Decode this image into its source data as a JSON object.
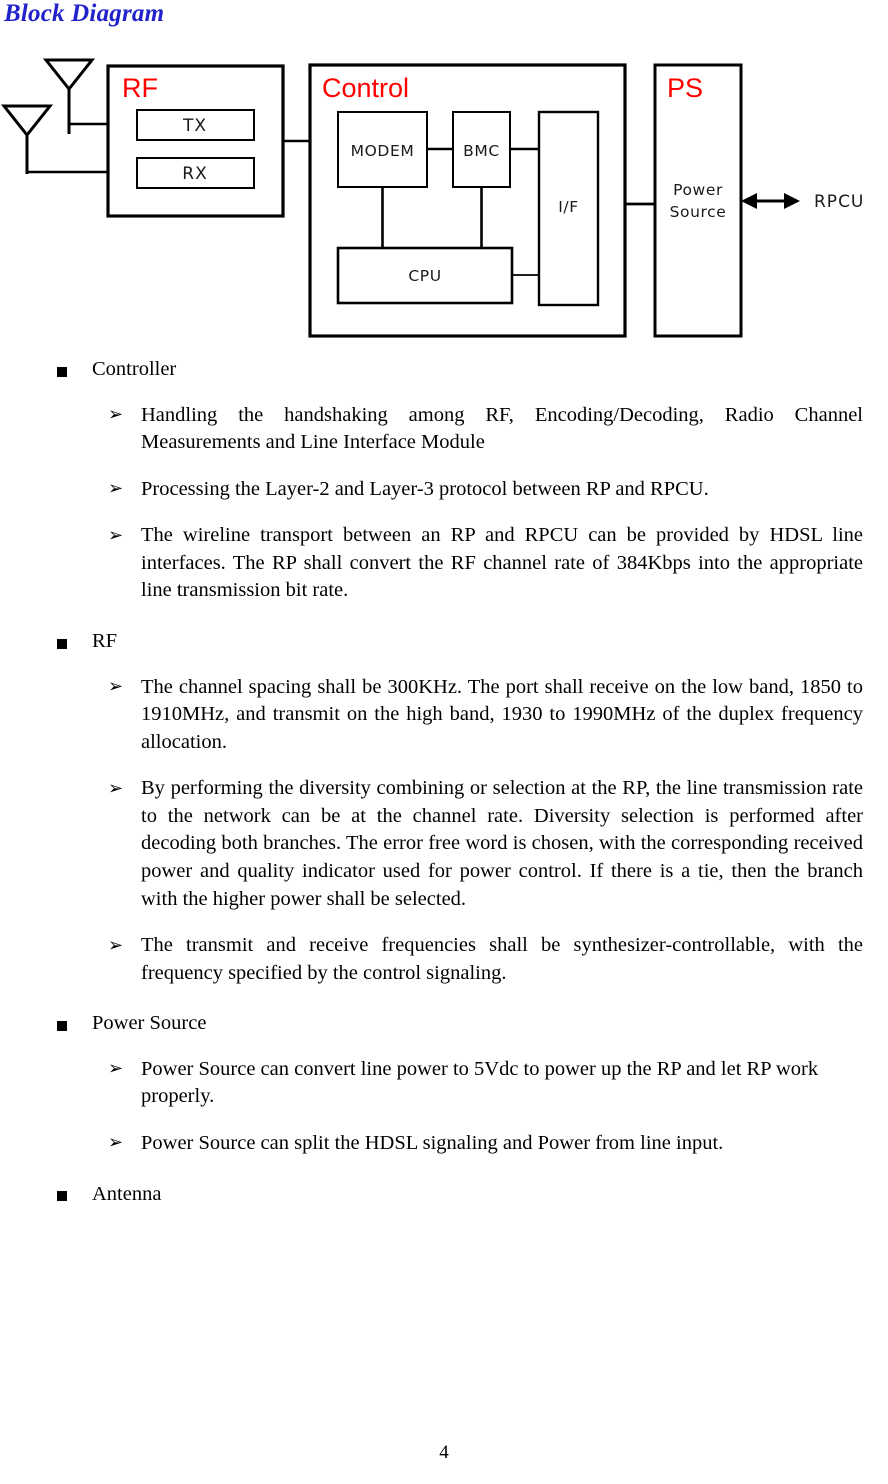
{
  "document": {
    "title": "Block Diagram",
    "title_color": "#2222cc",
    "page_number": "4"
  },
  "diagram": {
    "accent_color": "#ff0000",
    "line_color": "#000000",
    "blocks": [
      {
        "id": "rf",
        "label": "RF"
      },
      {
        "id": "control",
        "label": "Control"
      },
      {
        "id": "ps",
        "label": "PS"
      }
    ],
    "rf_children": [
      {
        "id": "tx",
        "label": "TX"
      },
      {
        "id": "rx",
        "label": "RX"
      }
    ],
    "control_children": [
      {
        "id": "modem",
        "label": "MODEM"
      },
      {
        "id": "bmc",
        "label": "BMC"
      },
      {
        "id": "if",
        "label": "I/F"
      },
      {
        "id": "cpu",
        "label": "CPU"
      }
    ],
    "ps_children": [
      {
        "id": "power-source",
        "label_line1": "Power",
        "label_line2": "Source"
      }
    ],
    "external": [
      {
        "id": "rpcu",
        "label": "RPCU"
      }
    ],
    "antennas": [
      {
        "id": "antenna-upper"
      },
      {
        "id": "antenna-lower"
      }
    ]
  },
  "sections": [
    {
      "heading": "Controller",
      "items": [
        "Handling the handshaking among RF, Encoding/Decoding, Radio Channel Measurements and Line Interface Module",
        "Processing the Layer-2 and Layer-3 protocol between RP and RPCU.",
        "The wireline transport between an RP and RPCU can be provided by HDSL line interfaces. The RP shall convert the RF channel rate of 384Kbps into the appropriate line transmission bit rate."
      ]
    },
    {
      "heading": "RF",
      "items": [
        "The channel spacing shall be 300KHz. The port shall receive on the low band, 1850 to 1910MHz, and transmit on the high band, 1930 to 1990MHz of the duplex frequency allocation.",
        "By performing the diversity combining or selection at the RP, the line transmission rate to the network can be at the channel rate. Diversity selection is performed after decoding both branches. The error free word is chosen, with the corresponding received power and quality indicator used for power control. If there is a tie, then the branch with the higher power shall be selected.",
        "The transmit and receive frequencies shall be synthesizer-controllable, with the frequency specified by the control signaling."
      ]
    },
    {
      "heading": "Power Source",
      "items": [
        "Power Source can convert line power to 5Vdc to power up the RP and let RP work properly.",
        "Power Source can split the HDSL signaling and Power from line input."
      ]
    },
    {
      "heading": "Antenna",
      "items": []
    }
  ],
  "bullets": {
    "level1_glyph": "square",
    "level2_glyph": "➢"
  }
}
